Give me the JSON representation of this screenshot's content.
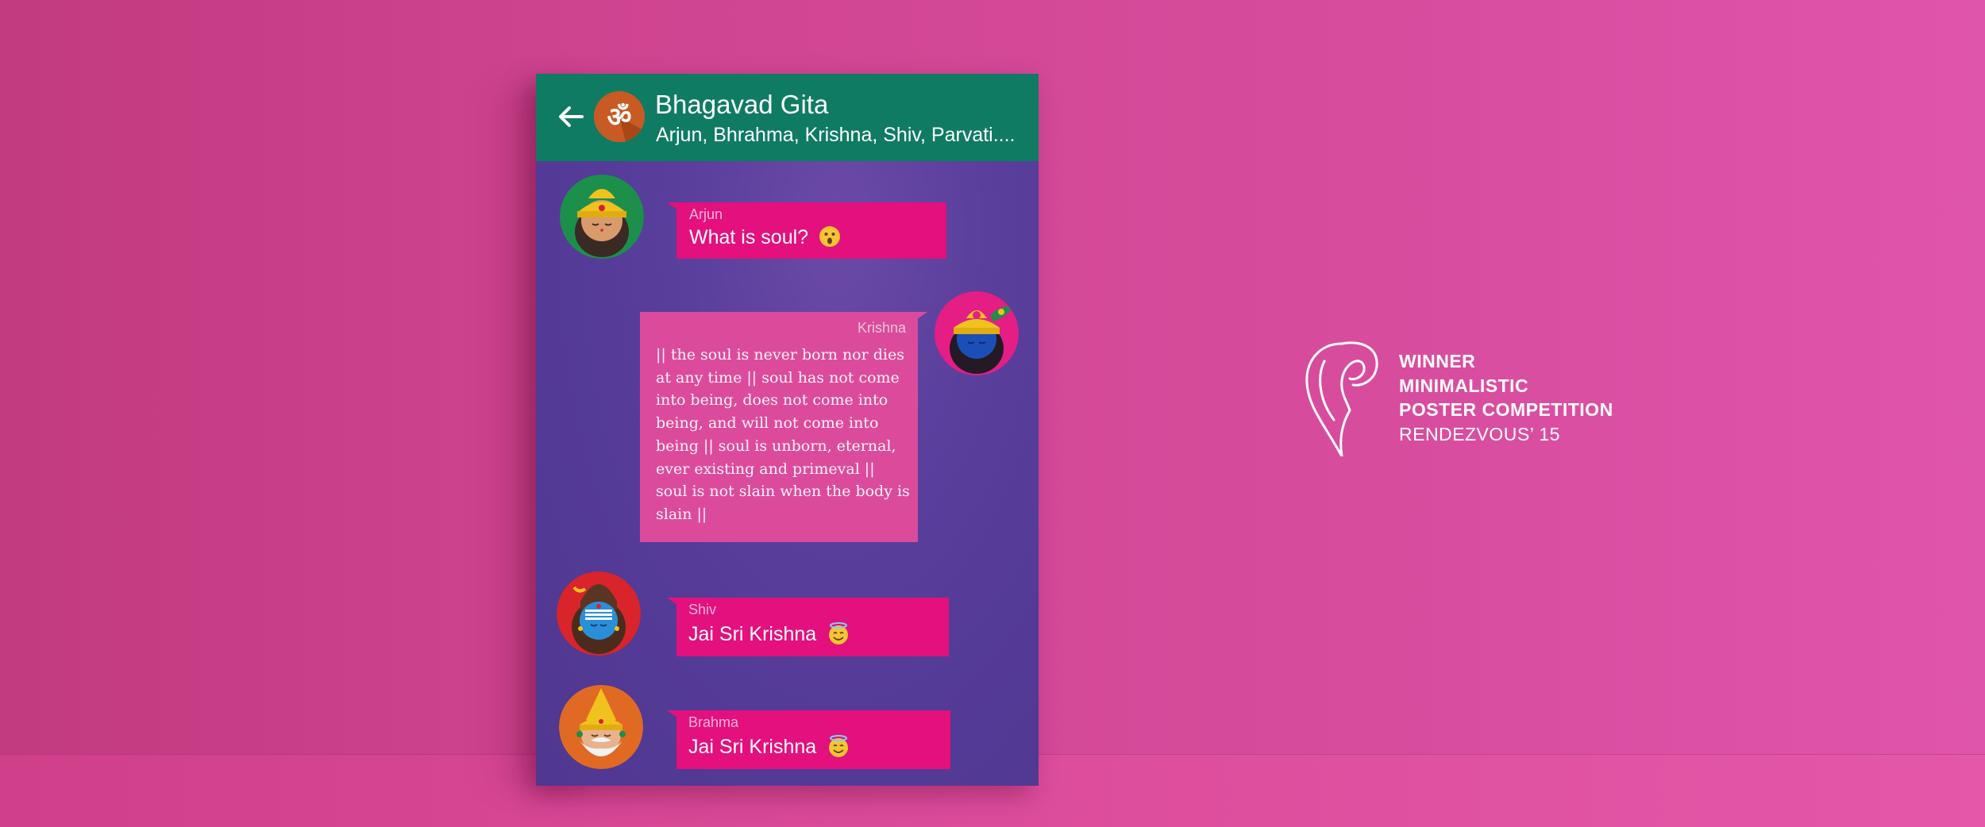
{
  "chat": {
    "title": "Bhagavad Gita",
    "participants": "Arjun, Bhrahma, Krishna, Shiv, Parvati....",
    "group_icon_glyph": "ॐ",
    "colors": {
      "header": "#0f7b63",
      "background": "#533a96",
      "bubble": "#e3107e",
      "bubble_reply": "#dc4b9b",
      "wall": "#d84c9e"
    },
    "messages": [
      {
        "sender": "Arjun",
        "text": "What is soul?",
        "emoji": "astonished-face"
      },
      {
        "sender": "Krishna",
        "text": "|| the soul is never born nor dies at any time || soul has not  come into being, does not come into being, and will not come into  being || soul is unborn, eternal, ever existing and primeval || soul is not slain when the body is slain ||"
      },
      {
        "sender": "Shiv",
        "text": "Jai Sri Krishna",
        "emoji": "smiling-face-with-halo"
      },
      {
        "sender": "Brahma",
        "text": "Jai Sri Krishna",
        "emoji": "smiling-face-with-halo"
      }
    ]
  },
  "award": {
    "line1": "WINNER",
    "line2": "MINIMALISTIC",
    "line3": "POSTER COMPETITION",
    "line4": "RENDEZVOUS’ 15"
  }
}
